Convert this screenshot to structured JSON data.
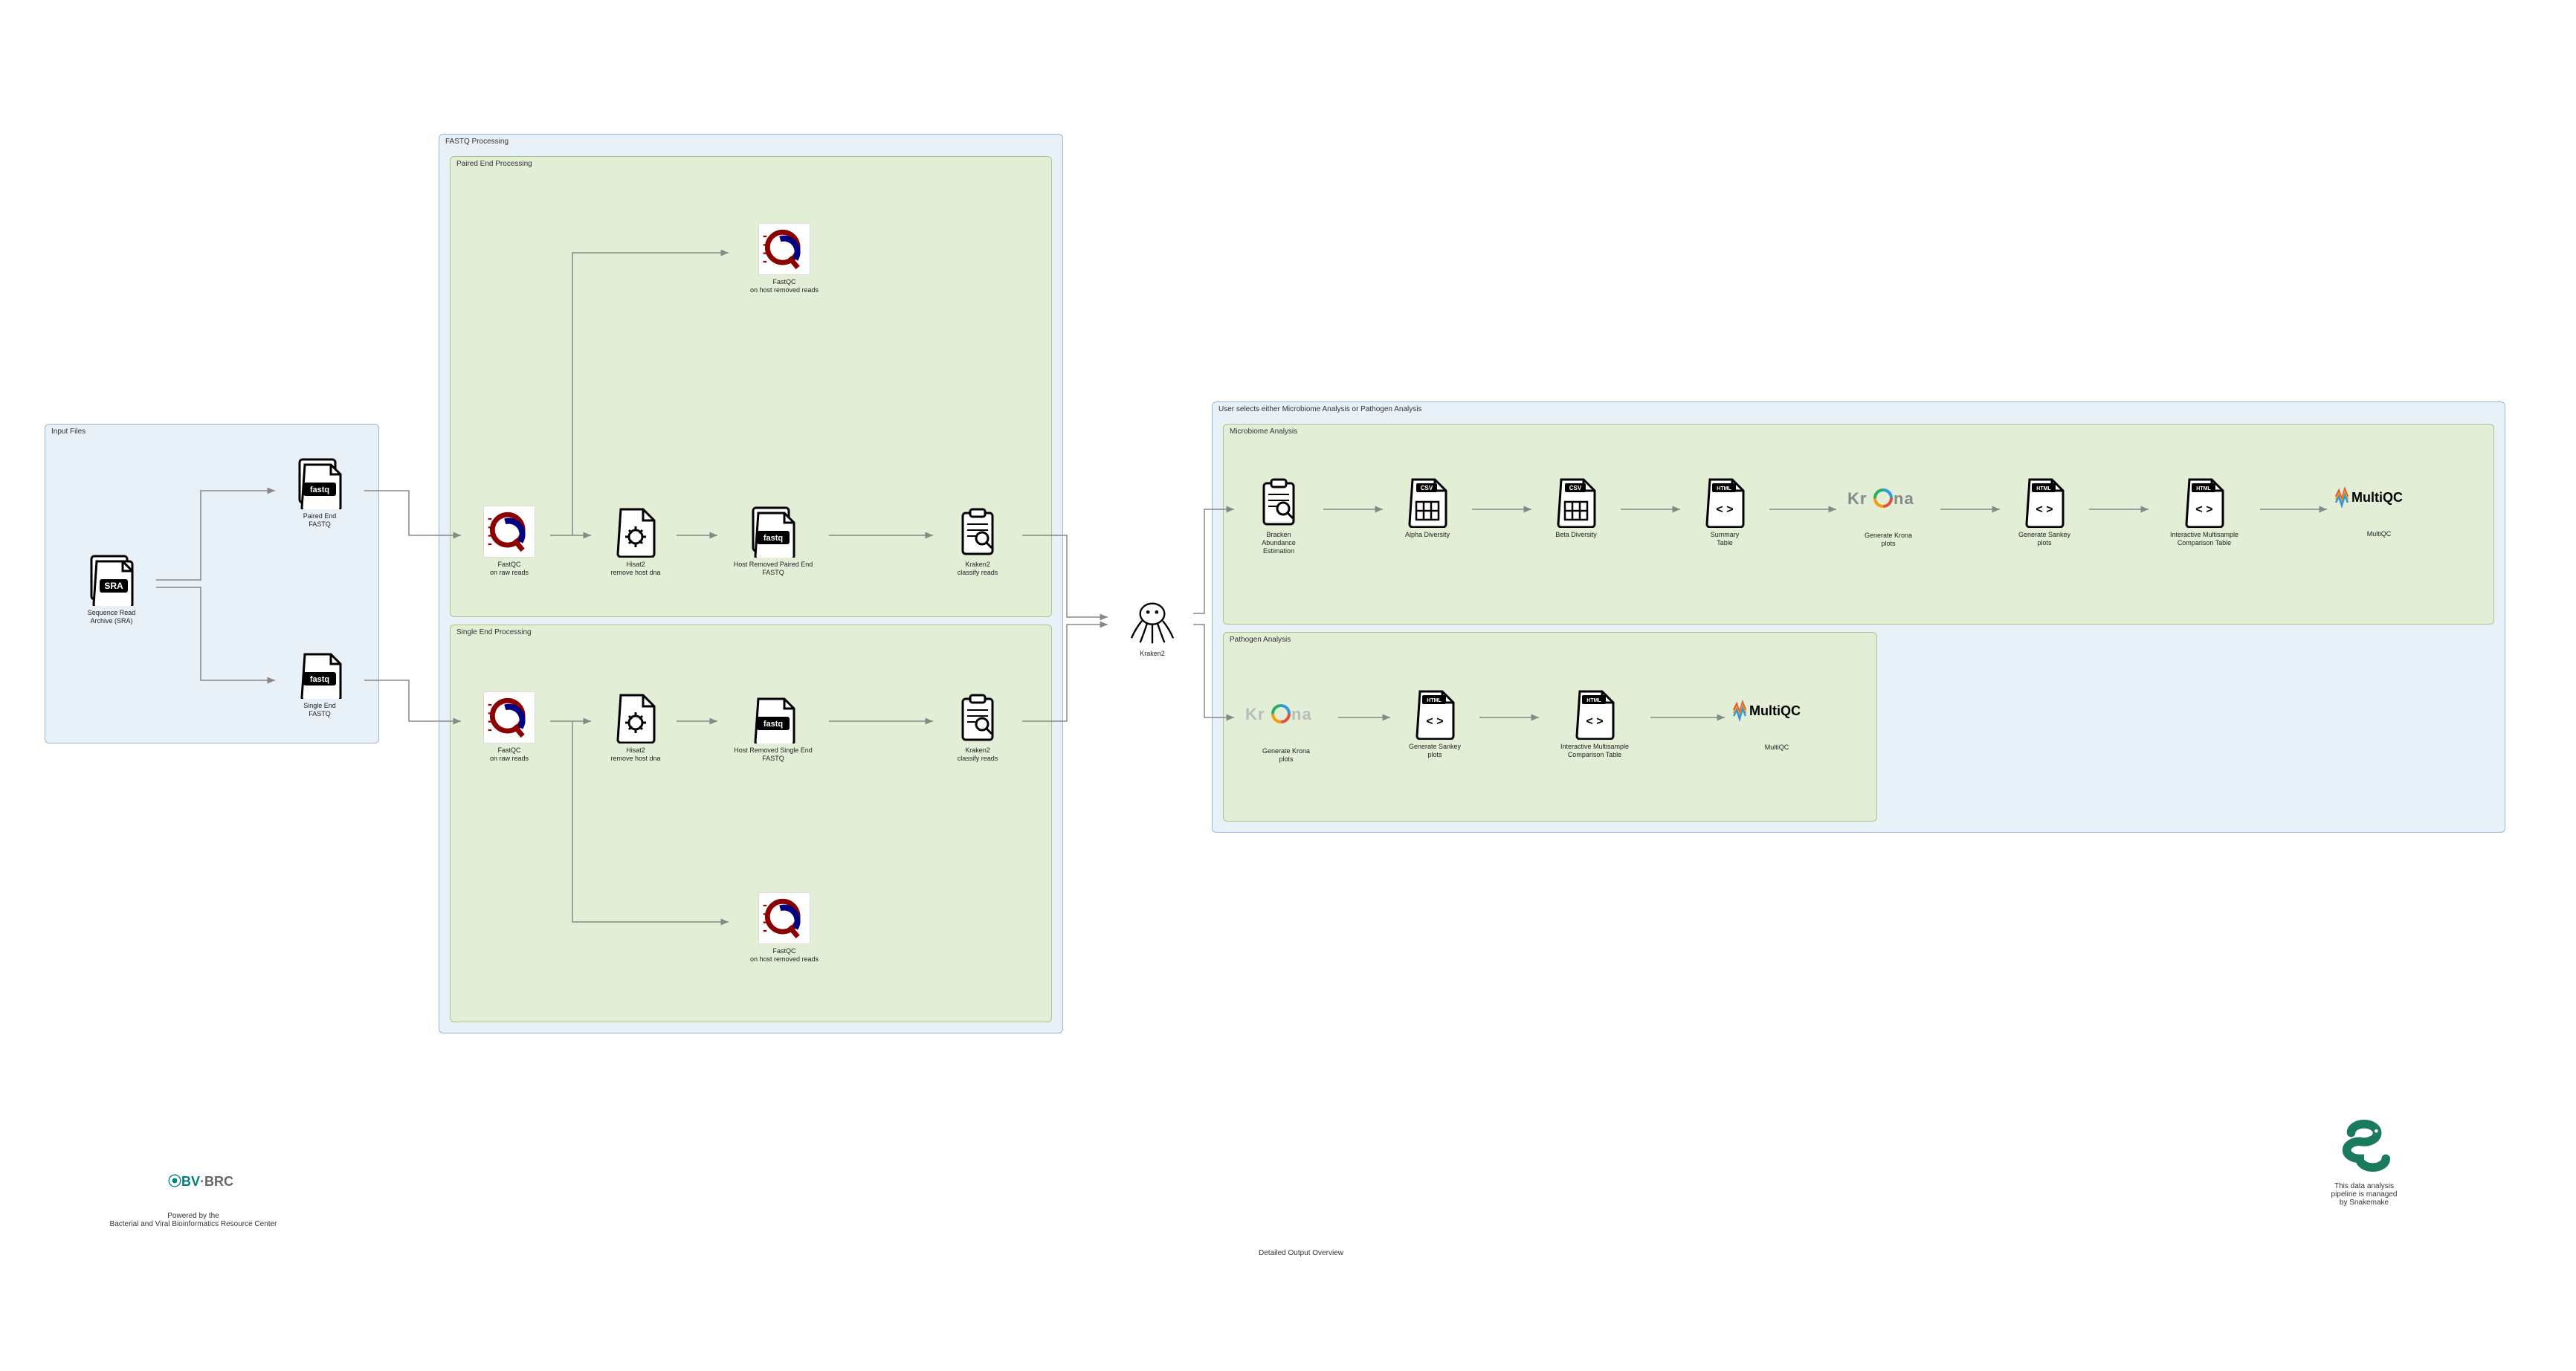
{
  "groups": {
    "input": "Input Files",
    "fastq": "FASTQ Processing",
    "paired": "Paired End Processing",
    "single": "Single End Processing",
    "user": "User selects either Microbiome Analysis or Pathogen Analysis",
    "micro": "Microbiome Analysis",
    "pathogen": "Pathogen Analysis"
  },
  "nodes": {
    "sra": "Sequence Read\nArchive (SRA)",
    "pe_fastq": "Paired End\nFASTQ",
    "se_fastq": "Single End\nFASTQ",
    "fastqc_raw_pe": "FastQC\non raw reads",
    "fastqc_raw_se": "FastQC\non raw reads",
    "hisat_pe": "Hisat2\nremove host dna",
    "hisat_se": "Hisat2\nremove host dna",
    "host_pe": "Host Removed Paired End\nFASTQ",
    "host_se": "Host Removed Single End\nFASTQ",
    "fastqc_host_pe": "FastQC\non host removed reads",
    "fastqc_host_se": "FastQC\non host removed reads",
    "kraken_pe": "Kraken2\nclassify reads",
    "kraken_se": "Kraken2\nclassify reads",
    "kraken2": "Kraken2",
    "bracken": "Bracken\nAbundance\nEstimation",
    "alpha": "Alpha Diversity",
    "beta": "Beta Diversity",
    "summary": "Summary\nTable",
    "krona_m": "Generate Krona\nplots",
    "sankey_m": "Generate Sankey\nplots",
    "interactive_m": "Interactive Multisample\nComparison Table",
    "multiqc_m": "MultiQC",
    "krona_p": "Generate Krona\nplots",
    "sankey_p": "Generate Sankey\nplots",
    "interactive_p": "Interactive Multisample\nComparison Table",
    "multiqc_p": "MultiQC"
  },
  "badges": {
    "csv": "CSV",
    "html": "HTML",
    "fastq_badge": "fastq",
    "sra_badge": "SRA"
  },
  "footer": {
    "bvbrc": "BV-BRC",
    "powered": "Powered by the\nBacterial and Viral Bioinformatics Resource Center",
    "detailed": "Detailed Output Overview",
    "snakemake": "This data analysis\npipeline is managed\nby Snakemake"
  },
  "logos": {
    "krona": "Krona",
    "multiqc": "MultiQC"
  }
}
